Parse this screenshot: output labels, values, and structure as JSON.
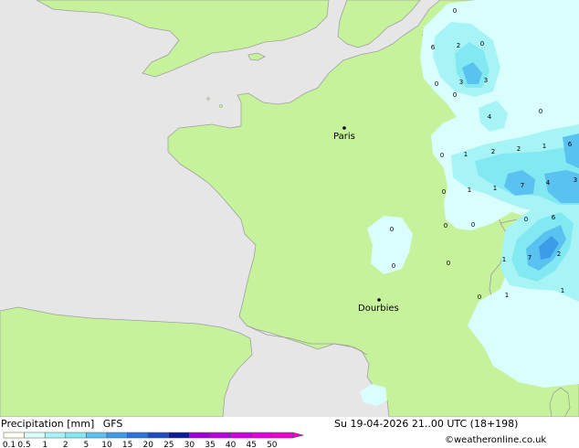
{
  "map": {
    "cities": [
      {
        "name": "Paris"
      },
      {
        "name": "Dourbies"
      }
    ],
    "values": [
      "0",
      "2",
      "0",
      "6",
      "0",
      "3",
      "3",
      "0",
      "0",
      "4",
      "0",
      "6",
      "1",
      "2",
      "2",
      "1",
      "0",
      "1",
      "1",
      "7",
      "4",
      "3",
      "0",
      "0",
      "0",
      "6",
      "0",
      "2",
      "1",
      "7",
      "0",
      "0",
      "1",
      "0",
      "1"
    ]
  },
  "footer": {
    "title": "Precipitation [mm]",
    "model": "GFS",
    "datetime": "Su 19-04-2026 21..00 UTC (18+198)",
    "credit": "©weatheronline.co.uk"
  },
  "legend": {
    "ticks": [
      "0.1",
      "0.5",
      "1",
      "2",
      "5",
      "10",
      "15",
      "20",
      "25",
      "30",
      "35",
      "40",
      "45",
      "50"
    ],
    "colors": [
      "#fffff0",
      "#dafefe",
      "#a6f4f6",
      "#82e8f2",
      "#5ac2f0",
      "#3c9ce8",
      "#2874d8",
      "#1c4cc0",
      "#0c1c9c",
      "#9c00dc",
      "#b800e6",
      "#d000e6",
      "#e400dc",
      "#f000c8"
    ]
  }
}
